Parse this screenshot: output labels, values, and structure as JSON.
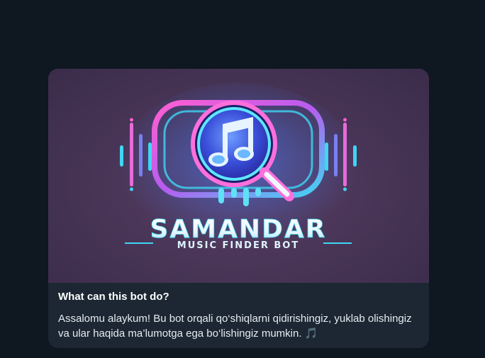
{
  "bot_intro": {
    "banner": {
      "logo_title": "SAMANDAR",
      "logo_subtitle": "MUSIC FINDER BOT",
      "logo_icon": "magnifier-music-note-icon"
    },
    "heading": "What can this bot do?",
    "description": "Assalomu alaykum! Bu bot orqali qo‘shiqlarni qidirishingiz, yuklab olishingiz va ular haqida ma’lumotga ega bo‘lishingiz mumkin.",
    "trailing_emoji": "🎵"
  },
  "colors": {
    "page_background": "#0f1721",
    "card_background": "#1c2733",
    "neon_pink": "#e54fd8",
    "neon_cyan": "#3fd6f2",
    "neon_blue": "#3b7bff"
  }
}
